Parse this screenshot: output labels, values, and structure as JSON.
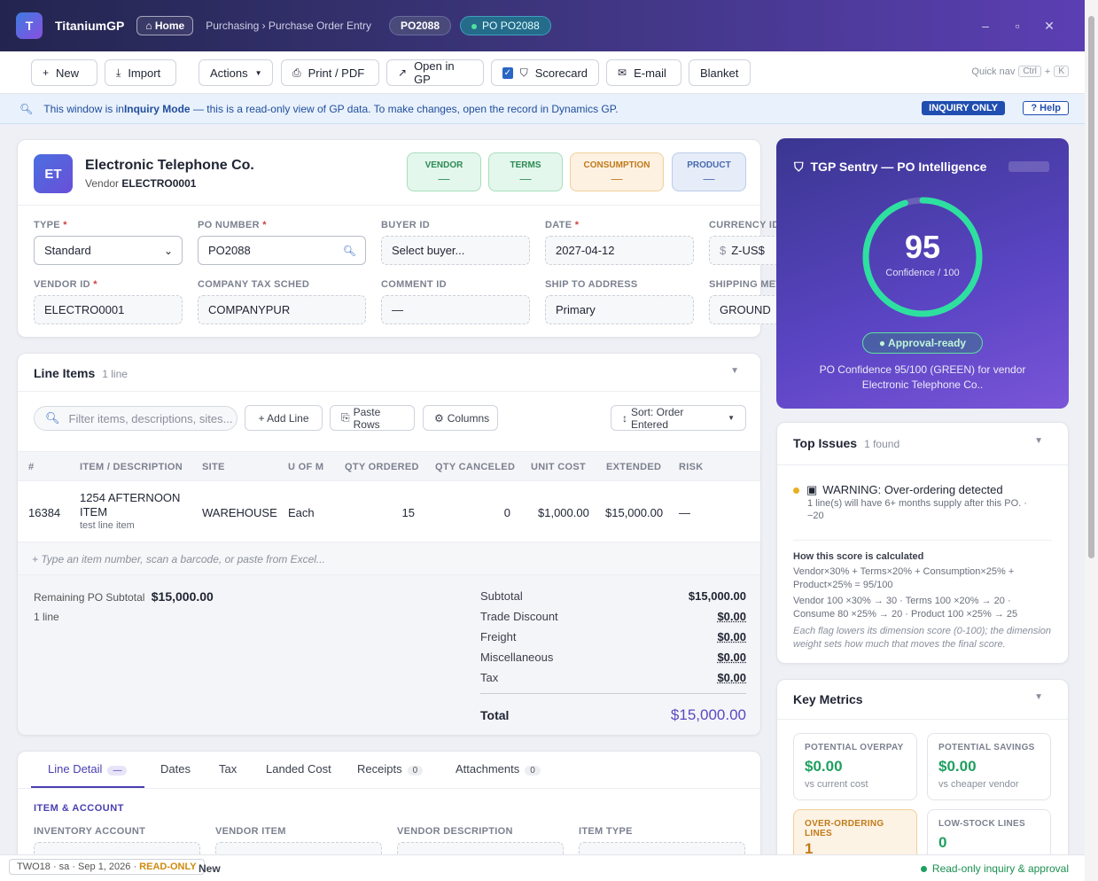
{
  "app": {
    "logo_letter": "T",
    "name": "TitaniumGP",
    "home": "⌂ Home",
    "breadcrumb": "Purchasing › Purchase Order Entry",
    "po_pill": "PO2088",
    "po_status_pill": "PO PO2088"
  },
  "window": {
    "minimize": "–",
    "maximize": "▫",
    "close": "✕"
  },
  "toolbar": {
    "new": "New",
    "import": "Import",
    "actions": "Actions",
    "print": "Print / PDF",
    "open_gp": "Open in GP",
    "scorecard": "Scorecard",
    "email": "E-mail",
    "blanket": "Blanket",
    "quick_nav": "Quick nav",
    "kbd_ctrl": "Ctrl",
    "kbd_plus": "+",
    "kbd_k": "K"
  },
  "inquiry": {
    "text_pre": "This window is in ",
    "text_bold": "Inquiry Mode",
    "text_post": " — this is a read-only view of GP data. To make changes, open the record in Dynamics GP.",
    "badge": "INQUIRY ONLY",
    "help": "? Help"
  },
  "vendor": {
    "initials": "ET",
    "name": "Electronic Telephone Co.",
    "sub_label": "Vendor",
    "sub_value": "ELECTRO0001",
    "chips": [
      {
        "label": "VENDOR",
        "value": "—"
      },
      {
        "label": "TERMS",
        "value": "—"
      },
      {
        "label": "CONSUMPTION",
        "value": "—"
      },
      {
        "label": "PRODUCT",
        "value": "—"
      }
    ],
    "fields": {
      "type": {
        "label": "TYPE",
        "value": "Standard"
      },
      "po_number": {
        "label": "PO NUMBER",
        "value": "PO2088"
      },
      "buyer_id": {
        "label": "BUYER ID",
        "value": "Select buyer..."
      },
      "date": {
        "label": "DATE",
        "value": "2027-04-12"
      },
      "currency_id": {
        "label": "CURRENCY ID",
        "value": "Z-US$",
        "prefix": "$"
      },
      "vendor_id": {
        "label": "VENDOR ID",
        "value": "ELECTRO0001"
      },
      "tax_sched": {
        "label": "COMPANY TAX SCHED",
        "value": "COMPANYPUR"
      },
      "comment_id": {
        "label": "COMMENT ID",
        "value": "—"
      },
      "ship_to": {
        "label": "SHIP TO ADDRESS",
        "value": "Primary"
      },
      "shipping_method": {
        "label": "SHIPPING METHOD",
        "value": "GROUND"
      }
    }
  },
  "line_items": {
    "title": "Line Items",
    "count": "1 line",
    "filter_placeholder": "Filter items, descriptions, sites...",
    "add_line": "+ Add Line",
    "paste_rows": "Paste Rows",
    "columns": "Columns",
    "sort": "Sort: Order Entered",
    "headers": [
      "#",
      "ITEM / DESCRIPTION",
      "SITE",
      "U OF M",
      "QTY ORDERED",
      "QTY CANCELED",
      "UNIT COST",
      "EXTENDED",
      "RISK"
    ],
    "rows": [
      {
        "num": "16384",
        "item_line1": "1254 AFTERNOON",
        "item_line2": "ITEM",
        "desc": "test line item",
        "site": "WAREHOUSE",
        "uom": "Each",
        "qty_ordered": "15",
        "qty_canceled": "0",
        "unit_cost": "$1,000.00",
        "extended": "$15,000.00",
        "risk": "—"
      }
    ],
    "add_row_hint": "+ Type an item number, scan a barcode, or paste from Excel...",
    "remaining_label": "Remaining PO Subtotal",
    "remaining_value": "$15,000.00",
    "remaining_lines": "1 line",
    "summary": [
      {
        "label": "Subtotal",
        "value": "$15,000.00"
      },
      {
        "label": "Trade Discount",
        "value": "$0.00"
      },
      {
        "label": "Freight",
        "value": "$0.00"
      },
      {
        "label": "Miscellaneous",
        "value": "$0.00"
      },
      {
        "label": "Tax",
        "value": "$0.00"
      }
    ],
    "total_label": "Total",
    "total_value": "$15,000.00"
  },
  "detail": {
    "tabs": [
      {
        "label": "Line Detail",
        "count": "—"
      },
      {
        "label": "Dates"
      },
      {
        "label": "Tax"
      },
      {
        "label": "Landed Cost"
      },
      {
        "label": "Receipts",
        "count": "0"
      },
      {
        "label": "Attachments",
        "count": "0"
      }
    ],
    "section": "ITEM & ACCOUNT",
    "fields": [
      "INVENTORY ACCOUNT",
      "VENDOR ITEM",
      "VENDOR DESCRIPTION",
      "ITEM TYPE"
    ]
  },
  "sentry": {
    "title": "TGP Sentry — PO Intelligence",
    "score": "95",
    "score_value": 95,
    "score_sub": "Confidence / 100",
    "status": "● Approval-ready",
    "desc": "PO Confidence 95/100 (GREEN) for vendor Electronic Telephone Co..",
    "accent": "#2ee0a0"
  },
  "issues": {
    "title": "Top Issues",
    "count": "1 found",
    "warning_title": "WARNING: Over-ordering detected",
    "warning_detail": "1 line(s) will have 6+ months supply after this PO. · −20",
    "how_title": "How this score is calculated",
    "formula": "Vendor×30% + Terms×20% + Consumption×25% + Product×25% = 95/100",
    "breakdown": "Vendor 100 ×30% → 30 · Terms 100 ×20% → 20 · Consume 80 ×25% → 20 · Product 100 ×25% → 25",
    "note": "Each flag lowers its dimension score (0-100); the dimension weight sets how much that moves the final score."
  },
  "metrics": {
    "title": "Key Metrics",
    "items": [
      {
        "label": "POTENTIAL OVERPAY",
        "value": "$0.00",
        "sub": "vs current cost"
      },
      {
        "label": "POTENTIAL SAVINGS",
        "value": "$0.00",
        "sub": "vs cheaper vendor"
      },
      {
        "label": "OVER-ORDERING LINES",
        "value": "1",
        "sub": ""
      },
      {
        "label": "LOW-STOCK LINES",
        "value": "0",
        "sub": ""
      }
    ]
  },
  "status": {
    "company": "TWO18 · sa · Sep 1, 2026 · ",
    "mode": "READ-ONLY",
    "doc_state": "New",
    "right": "Read-only inquiry & approval"
  }
}
